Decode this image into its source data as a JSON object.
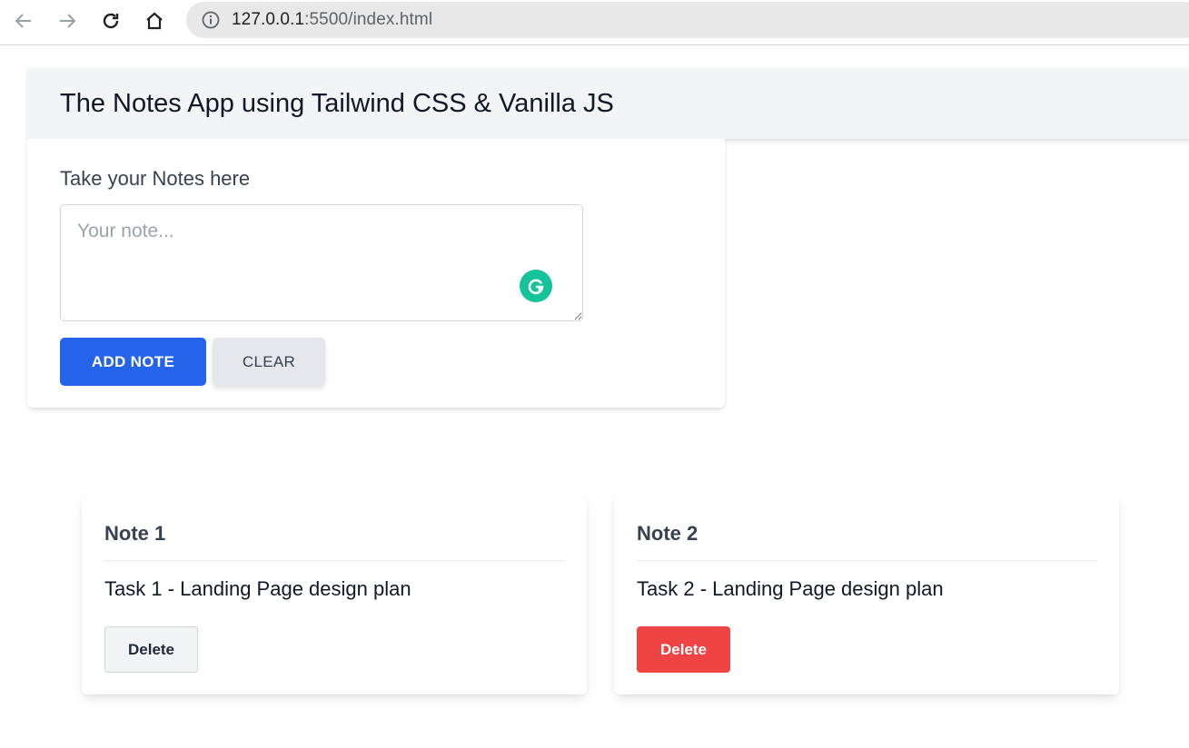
{
  "browser": {
    "url_host": "127.0.0.1",
    "url_rest": ":5500/index.html",
    "icons": [
      "back-arrow-icon",
      "forward-arrow-icon",
      "reload-icon",
      "home-icon",
      "info-icon"
    ]
  },
  "header": {
    "title": "The Notes App using Tailwind CSS & Vanilla JS"
  },
  "input": {
    "label": "Take your Notes here",
    "placeholder": "Your note...",
    "value": "",
    "add_label": "ADD NOTE",
    "clear_label": "CLEAR"
  },
  "notes": [
    {
      "title": "Note 1",
      "body": "Task 1 - Landing Page design plan",
      "delete_label": "Delete",
      "delete_style": "plain"
    },
    {
      "title": "Note 2",
      "body": "Task 2 - Landing Page design plan",
      "delete_label": "Delete",
      "delete_style": "danger"
    }
  ],
  "colors": {
    "primary": "#2563eb",
    "danger": "#ef4444",
    "header_bg": "#f3f4f6",
    "grammarly": "#15c39a"
  }
}
